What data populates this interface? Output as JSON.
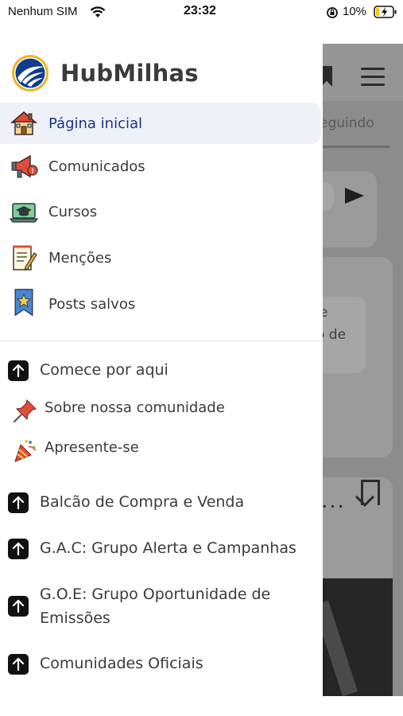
{
  "status_bar": {
    "carrier": "Nenhum SIM",
    "time": "23:32",
    "battery_percent": "10%"
  },
  "background_app": {
    "tab_label": "eguindo",
    "text_line_1": "e",
    "text_line_2": "o de",
    "more_label": "..."
  },
  "drawer": {
    "app_name": "HubMilhas",
    "nav_items": [
      {
        "label": "Página inicial",
        "icon": "house-icon",
        "active": true
      },
      {
        "label": "Comunicados",
        "icon": "megaphone-icon",
        "active": false
      },
      {
        "label": "Cursos",
        "icon": "graduation-laptop-icon",
        "active": false
      },
      {
        "label": "Menções",
        "icon": "notepad-pencil-icon",
        "active": false
      },
      {
        "label": "Posts salvos",
        "icon": "bookmark-star-icon",
        "active": false
      }
    ],
    "sections": [
      {
        "label": "Comece por aqui",
        "icon": "arrow-up-icon"
      },
      {
        "label": "Sobre nossa comunidade",
        "icon": "pushpin-icon"
      },
      {
        "label": "Apresente-se",
        "icon": "party-popper-icon"
      },
      {
        "label": "Balcão de Compra e Venda",
        "icon": "arrow-up-icon"
      },
      {
        "label": "G.A.C: Grupo Alerta e Campanhas",
        "icon": "arrow-up-icon"
      },
      {
        "label_line_1": "G.O.E: Grupo Oportunidade de",
        "label_line_2": "Emissões",
        "icon": "arrow-up-icon"
      },
      {
        "label": "Comunidades Oficiais",
        "icon": "arrow-up-icon"
      }
    ]
  },
  "colors": {
    "active_item_bg": "#eef1f8",
    "active_item_text": "#1c3488",
    "overlay_gray": "#8c8c8c",
    "logo_blue": "#0f3d8c",
    "logo_gold": "#f0b323"
  }
}
